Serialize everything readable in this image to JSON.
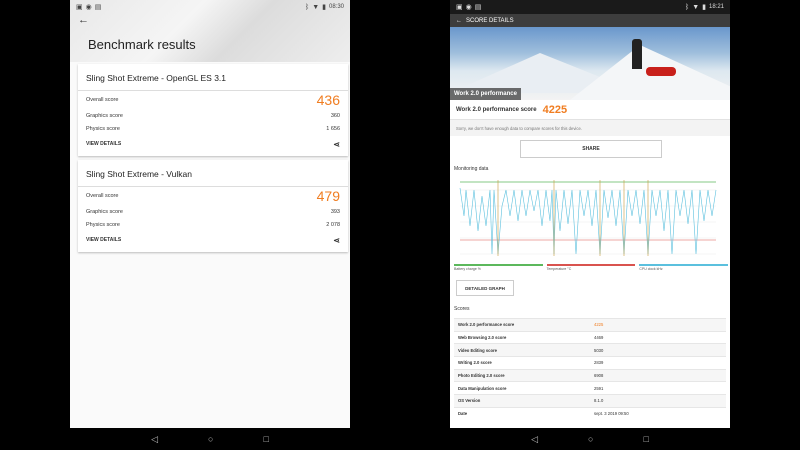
{
  "left": {
    "status": {
      "time": "08:30"
    },
    "page_title": "Benchmark results",
    "cards": [
      {
        "title": "Sling Shot Extreme - OpenGL ES 3.1",
        "overall_label": "Overall score",
        "overall": "436",
        "graphics_label": "Graphics score",
        "graphics": "360",
        "physics_label": "Physics score",
        "physics": "1 656",
        "view_details": "VIEW DETAILS"
      },
      {
        "title": "Sling Shot Extreme - Vulkan",
        "overall_label": "Overall score",
        "overall": "479",
        "graphics_label": "Graphics score",
        "graphics": "393",
        "physics_label": "Physics score",
        "physics": "2 078",
        "view_details": "VIEW DETAILS"
      }
    ]
  },
  "right": {
    "status": {
      "time": "18:21"
    },
    "appbar_title": "SCORE DETAILS",
    "image_label": "Work 2.0 performance",
    "score_label": "Work 2.0 performance score",
    "score": "4225",
    "sorry": "Sorry, we don't have enough data to compare scores for this device.",
    "share_label": "SHARE",
    "monitoring_label": "Monitoring data",
    "legend": [
      "Battery charge %",
      "Temperature °C",
      "CPU clock kHz"
    ],
    "detailed_label": "DETAILED GRAPH",
    "scores_header": "Scores",
    "scores": [
      {
        "k": "Work 2.0 performance score",
        "v": "4225"
      },
      {
        "k": "Web Browsing 2.0 score",
        "v": "4469"
      },
      {
        "k": "Video Editing score",
        "v": "5030"
      },
      {
        "k": "Writing 2.0 score",
        "v": "2839"
      },
      {
        "k": "Photo Editing 2.0 score",
        "v": "6908"
      },
      {
        "k": "Data Manipulation score",
        "v": "2591"
      },
      {
        "k": "OS Version",
        "v": "8.1.0"
      },
      {
        "k": "Date",
        "v": "sept. 3 2019 09:50"
      }
    ],
    "chart_colors": {
      "battery": "#5cb85c",
      "temperature": "#d9534f",
      "cpu": "#5bc0de"
    }
  },
  "colors": {
    "accent": "#f07d21"
  }
}
